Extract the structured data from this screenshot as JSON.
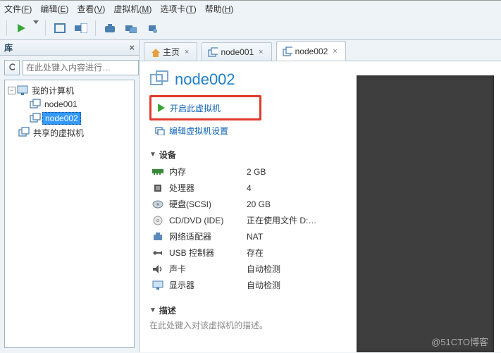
{
  "menu": {
    "file": "文件(",
    "file_u": "F",
    "edit": "编辑(",
    "edit_u": "E",
    "view": "查看(",
    "view_u": "V",
    "vm": "虚拟机(",
    "vm_u": "M",
    "tabs": "选项卡(",
    "tabs_u": "T",
    "help": "帮助(",
    "help_u": "H",
    "close": ")"
  },
  "sidebar": {
    "title": "库",
    "search_placeholder": "在此处键入内容进行…",
    "items": [
      {
        "lvl": 0,
        "tgl": "−",
        "icon": "monitor",
        "label": "我的计算机"
      },
      {
        "lvl": 1,
        "tgl": null,
        "icon": "vm",
        "label": "node001"
      },
      {
        "lvl": 1,
        "tgl": null,
        "icon": "vm",
        "label": "node002",
        "sel": true
      },
      {
        "lvl": 0,
        "tgl": null,
        "icon": "share",
        "label": "共享的虚拟机"
      }
    ]
  },
  "tabs": [
    {
      "icon": "home",
      "label": "主页",
      "active": false
    },
    {
      "icon": "vm",
      "label": "node001",
      "active": false
    },
    {
      "icon": "vm",
      "label": "node002",
      "active": true
    }
  ],
  "vm": {
    "title": "node002",
    "start_link": "开启此虚拟机",
    "edit_link": "编辑虚拟机设置",
    "dev_header": "设备",
    "devices": [
      {
        "icon": "mem",
        "label": "内存",
        "value": "2 GB"
      },
      {
        "icon": "cpu",
        "label": "处理器",
        "value": "4"
      },
      {
        "icon": "disk",
        "label": "硬盘(SCSI)",
        "value": "20 GB"
      },
      {
        "icon": "cd",
        "label": "CD/DVD (IDE)",
        "value": "正在使用文件 D:…"
      },
      {
        "icon": "net",
        "label": "网络适配器",
        "value": "NAT"
      },
      {
        "icon": "usb",
        "label": "USB 控制器",
        "value": "存在"
      },
      {
        "icon": "snd",
        "label": "声卡",
        "value": "自动检测"
      },
      {
        "icon": "dsp",
        "label": "显示器",
        "value": "自动检测"
      }
    ],
    "desc_header": "描述",
    "desc_text": "在此处键入对该虚拟机的描述。"
  },
  "watermark": "@51CTO博客"
}
